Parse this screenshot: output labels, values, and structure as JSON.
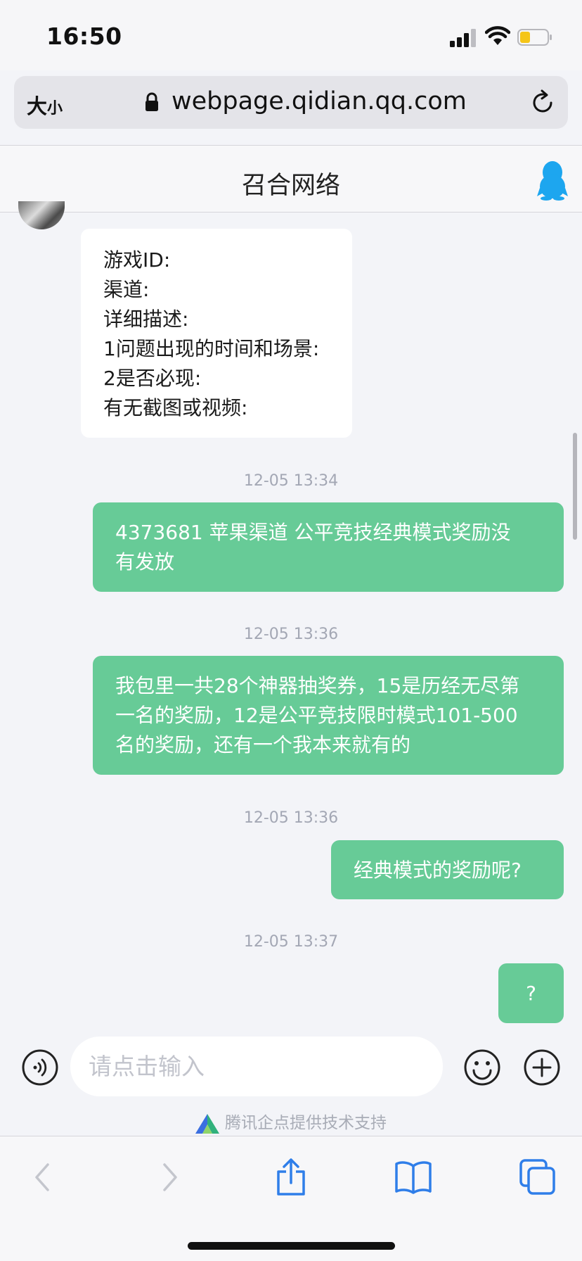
{
  "status_bar": {
    "time": "16:50"
  },
  "browser": {
    "text_size_large": "大",
    "text_size_small": "小",
    "url": "webpage.qidian.qq.com"
  },
  "chat": {
    "title": "召合网络",
    "incoming_form": [
      "游戏ID:",
      "渠道:",
      "详细描述:",
      "1问题出现的时间和场景:",
      "2是否必现:",
      "有无截图或视频:"
    ],
    "messages": [
      {
        "timestamp": "12-05 13:34",
        "lines": [
          "4373681 苹果渠道 公平竞技经典模式奖励没",
          "有发放"
        ]
      },
      {
        "timestamp": "12-05 13:36",
        "lines": [
          "我包里一共28个神器抽奖券，15是历经无尽第",
          "一名的奖励，12是公平竞技限时模式101-500",
          "名的奖励，还有一个我本来就有的"
        ]
      },
      {
        "timestamp": "12-05 13:36",
        "lines": [
          "经典模式的奖励呢?"
        ]
      },
      {
        "timestamp": "12-05 13:37",
        "lines": [
          "?"
        ]
      }
    ]
  },
  "input": {
    "placeholder": "请点击输入",
    "powered_by": "腾讯企点提供技术支持"
  },
  "colors": {
    "bubble_outgoing": "#67cb97",
    "accent_blue": "#2f7ee9",
    "qq_blue": "#1da6ef"
  },
  "icons": [
    "signal-icon",
    "wifi-icon",
    "battery-icon",
    "lock-icon",
    "reload-icon",
    "qq-penguin-icon",
    "voice-icon",
    "emoji-icon",
    "plus-icon",
    "back-icon",
    "forward-icon",
    "share-icon",
    "bookmarks-icon",
    "tabs-icon"
  ]
}
